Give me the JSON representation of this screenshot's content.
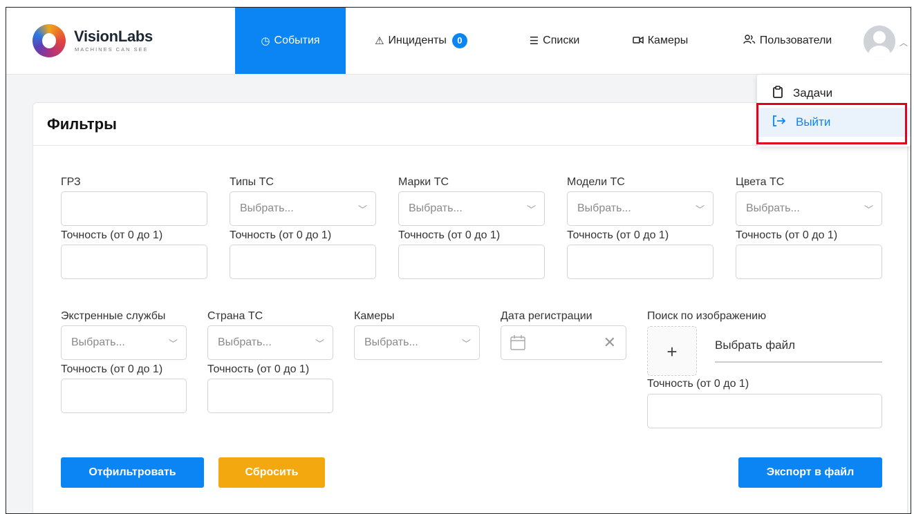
{
  "brand": {
    "name": "VisionLabs",
    "tagline": "MACHINES CAN SEE"
  },
  "nav": {
    "events": "События",
    "incidents": "Инциденты",
    "incidents_count": "0",
    "lists": "Списки",
    "cameras": "Камеры",
    "users": "Пользователи"
  },
  "user_menu": {
    "tasks": "Задачи",
    "logout": "Выйти"
  },
  "filters": {
    "title": "Фильтры",
    "precision_label": "Точность (от 0 до 1)",
    "select_placeholder": "Выбрать...",
    "row1": {
      "plate": "ГРЗ",
      "types": "Типы ТС",
      "brands": "Марки ТС",
      "models": "Модели ТС",
      "colors": "Цвета ТС"
    },
    "row2": {
      "emergency": "Экстренные службы",
      "country": "Страна ТС",
      "cameras": "Камеры",
      "reg_date": "Дата регистрации",
      "image_search": "Поиск по изображению",
      "choose_file": "Выбрать файл"
    }
  },
  "buttons": {
    "filter": "Отфильтровать",
    "reset": "Сбросить",
    "export": "Экспорт в файл"
  },
  "colors": {
    "accent": "#0b84f4",
    "reset": "#f4a80f",
    "highlight": "#e4001b"
  }
}
